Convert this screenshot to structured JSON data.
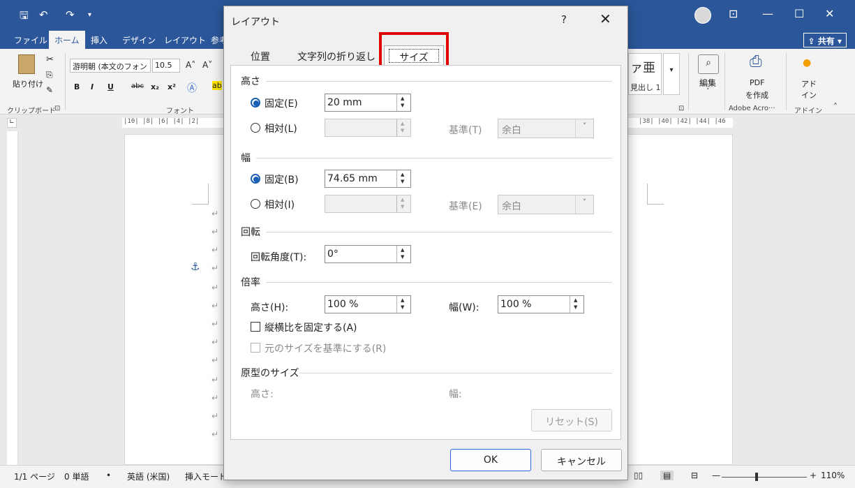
{
  "word": {
    "quick_access": [
      "🖫",
      "↶",
      "↷",
      "▾"
    ],
    "window_buttons": [
      "⊡",
      "—",
      "☐",
      "✕"
    ],
    "ribbon_tabs": [
      "ファイル",
      "ホーム",
      "挿入",
      "デザイン",
      "レイアウト",
      "参考"
    ],
    "share_label": "共有",
    "paste_label": "貼り付け",
    "font_name": "游明朝 (本文のフォン",
    "font_size": "10.5",
    "clipboard_label": "クリップボード",
    "font_group_label": "フォント",
    "style_preview": "ァ亜",
    "style_name": "見出し 1",
    "edit_label": "編集",
    "pdf_label_1": "PDF",
    "pdf_label_2": "を作成",
    "adobe_group": "Adobe Acro···",
    "addin_label_1": "アド",
    "addin_label_2": "イン",
    "addin_group": "アドイン",
    "ruler_left": "|10|  |8|  |6|  |4|  |2|",
    "ruler_right": "|38|  |40|  |42|  |44|  |46",
    "status": {
      "page": "1/1 ページ",
      "words": "0 単語",
      "lang": "英語 (米国)",
      "mode": "挿入モード",
      "zoom": "110%"
    }
  },
  "dialog": {
    "title": "レイアウト",
    "help": "?",
    "close": "✕",
    "tabs": [
      "位置",
      "文字列の折り返し",
      "サイズ"
    ],
    "height_section": "高さ",
    "height_fixed_label": "固定(E)",
    "height_fixed_value": "20 mm",
    "height_relative_label": "相対(L)",
    "height_relative_value": "",
    "height_basis_label": "基準(T)",
    "height_basis_value": "余白",
    "width_section": "幅",
    "width_fixed_label": "固定(B)",
    "width_fixed_value": "74.65 mm",
    "width_relative_label": "相対(I)",
    "width_relative_value": "",
    "width_basis_label": "基準(E)",
    "width_basis_value": "余白",
    "rotate_section": "回転",
    "rotate_label": "回転角度(T):",
    "rotate_value": "0°",
    "scale_section": "倍率",
    "scale_height_label": "高さ(H):",
    "scale_height_value": "100 %",
    "scale_width_label": "幅(W):",
    "scale_width_value": "100 %",
    "lock_aspect_label": "縦横比を固定する(A)",
    "relative_original_label": "元のサイズを基準にする(R)",
    "original_section": "原型のサイズ",
    "original_height_label": "高さ:",
    "original_width_label": "幅:",
    "reset_label": "リセット(S)",
    "ok_label": "OK",
    "cancel_label": "キャンセル"
  }
}
